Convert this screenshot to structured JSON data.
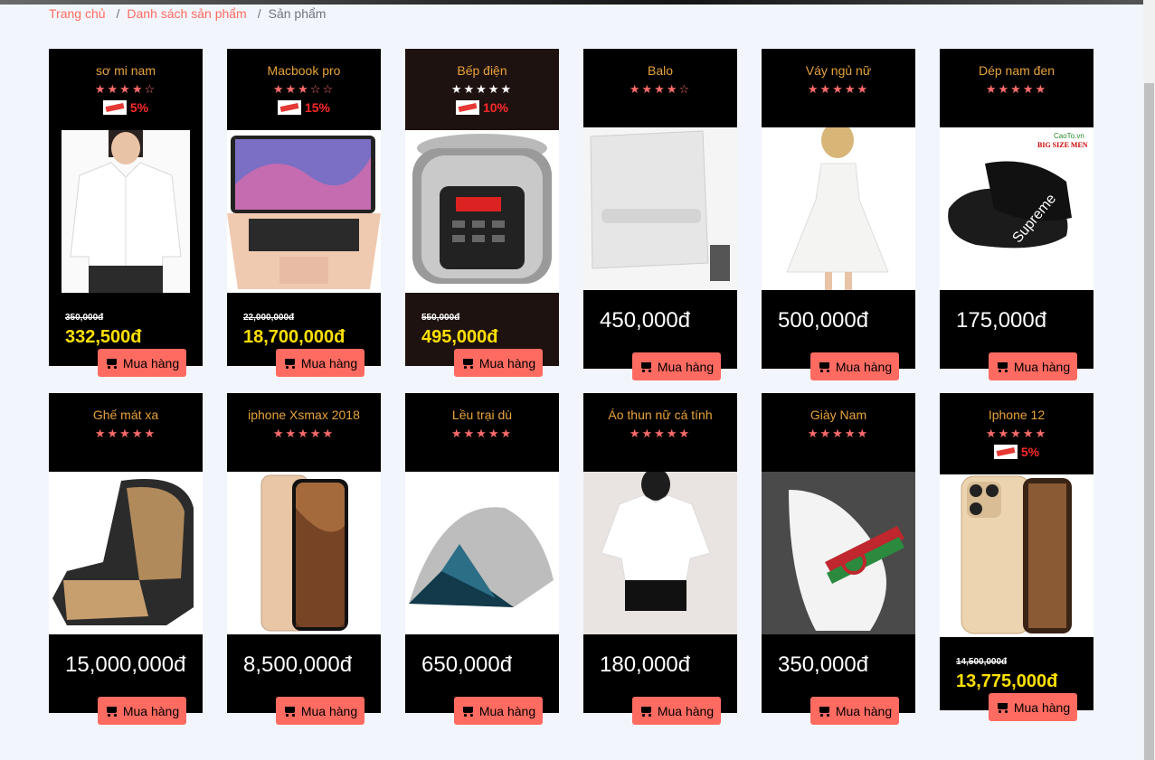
{
  "breadcrumb": {
    "items": [
      "Trang chủ",
      "Danh sách sản phẩm"
    ],
    "current": "Sản phẩm"
  },
  "buy_label": "Mua hàng",
  "products": [
    {
      "name": "sơ mi nam",
      "rating": 4,
      "sale": "5%",
      "old_price": "350,000đ",
      "price": "332,500đ"
    },
    {
      "name": "Macbook pro",
      "rating": 3,
      "sale": "15%",
      "old_price": "22,000,000đ",
      "price": "18,700,000đ"
    },
    {
      "name": "Bếp điện",
      "rating": 5,
      "sale": "10%",
      "old_price": "550,000đ",
      "price": "495,000đ"
    },
    {
      "name": "Balo",
      "rating": 4,
      "price": "450,000đ"
    },
    {
      "name": "Váy ngủ nữ",
      "rating": 5,
      "price": "500,000đ"
    },
    {
      "name": "Dép nam đen",
      "rating": 5,
      "price": "175,000đ",
      "image_text": [
        "CaoTo.vn",
        "BIG SIZE MEN",
        "Supreme"
      ]
    },
    {
      "name": "Ghế mát xa",
      "rating": 5,
      "price": "15,000,000đ"
    },
    {
      "name": "iphone Xsmax 2018",
      "rating": 5,
      "price": "8,500,000đ"
    },
    {
      "name": "Lều trại dù",
      "rating": 5,
      "price": "650,000đ"
    },
    {
      "name": "Áo thun nữ cá tính",
      "rating": 5,
      "price": "180,000đ"
    },
    {
      "name": "Giày Nam",
      "rating": 5,
      "price": "350,000đ"
    },
    {
      "name": "Iphone 12",
      "rating": 5,
      "sale": "5%",
      "old_price": "14,500,000đ",
      "price": "13,775,000đ"
    }
  ],
  "colors": {
    "accent": "#ff6b61",
    "price_sale": "#ffe000",
    "name": "#e6a23c",
    "star": "#ff6b6b"
  }
}
